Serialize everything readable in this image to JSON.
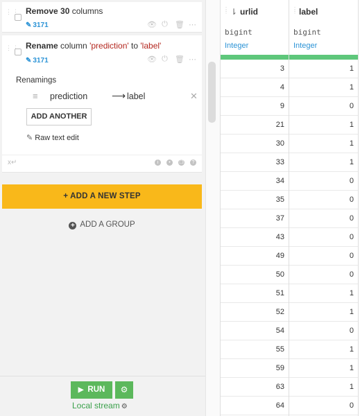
{
  "steps": {
    "step1": {
      "title_bold_count": "30",
      "title_prefix": "Remove",
      "title_suffix": "columns",
      "badge": "3171"
    },
    "step2": {
      "title_bold": "Rename",
      "title_mid1": "column",
      "from_quoted": "'prediction'",
      "title_mid2": "to",
      "to_quoted": "'label'",
      "badge": "3171",
      "renamings_label": "Renamings",
      "renaming_from": "prediction",
      "renaming_to": "label",
      "add_another_label": "ADD ANOTHER",
      "raw_text_edit_label": "Raw text edit",
      "footer_symbol": "x↵"
    }
  },
  "add_step_label": "+ ADD A NEW STEP",
  "add_group_label": "ADD A GROUP",
  "run_label": "RUN",
  "local_stream_label": "Local stream",
  "table": {
    "columns": [
      {
        "name": "urlid",
        "type": "bigint",
        "meaning": "Integer"
      },
      {
        "name": "label",
        "type": "bigint",
        "meaning": "Integer"
      }
    ],
    "rows": [
      [
        "3",
        "1"
      ],
      [
        "4",
        "1"
      ],
      [
        "9",
        "0"
      ],
      [
        "21",
        "1"
      ],
      [
        "30",
        "1"
      ],
      [
        "33",
        "1"
      ],
      [
        "34",
        "0"
      ],
      [
        "35",
        "0"
      ],
      [
        "37",
        "0"
      ],
      [
        "43",
        "0"
      ],
      [
        "49",
        "0"
      ],
      [
        "50",
        "0"
      ],
      [
        "51",
        "1"
      ],
      [
        "52",
        "1"
      ],
      [
        "54",
        "0"
      ],
      [
        "55",
        "1"
      ],
      [
        "59",
        "1"
      ],
      [
        "63",
        "1"
      ],
      [
        "64",
        "0"
      ]
    ]
  },
  "colors": {
    "accent_yellow": "#f9b81a",
    "run_green": "#5cb85c",
    "badge_blue": "#2b93d6",
    "valid_bar_green": "#5ec77b"
  }
}
